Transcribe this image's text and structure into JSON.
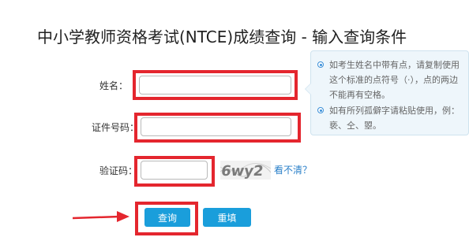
{
  "page": {
    "title": "中小学教师资格考试(NTCE)成绩查询 - 输入查询条件"
  },
  "form": {
    "name_label": "姓名：",
    "name_value": "",
    "id_label": "证件号码：",
    "id_value": "",
    "captcha_label": "验证码：",
    "captcha_value": "",
    "captcha_image_text": "6wy2",
    "refresh_link": "看不清？",
    "query_button": "查询",
    "reset_button": "重填"
  },
  "tips": [
    "如考生姓名中带有点，请复制使用这个标准的点符号（·），点的两边不能再有空格。",
    "如有所列孤僻字请粘贴使用，例：亵、仝、曌。"
  ],
  "colors": {
    "highlight": "#e4262e",
    "button": "#1a9edb",
    "link": "#2b80c9",
    "tip_background": "#eef6fb"
  }
}
